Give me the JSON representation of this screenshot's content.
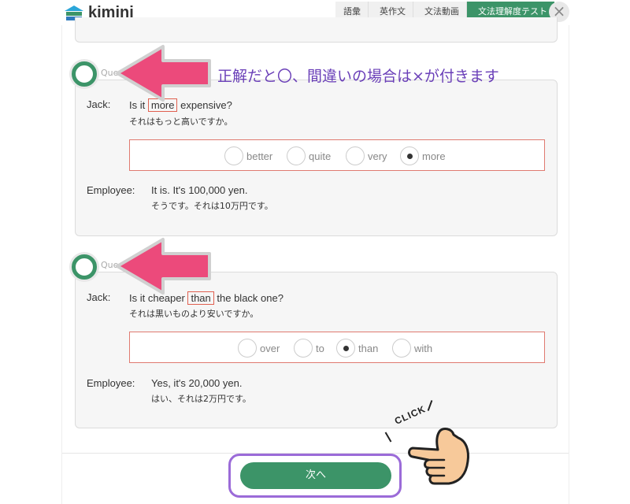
{
  "app": {
    "logo_text": "kimini"
  },
  "nav": {
    "tabs": [
      {
        "label": "語彙"
      },
      {
        "label": "英作文"
      },
      {
        "label": "文法動画"
      },
      {
        "label": "文法理解度テスト"
      }
    ],
    "close_glyph": "×"
  },
  "annotation": {
    "text": "正解だと〇、間違いの場合は×が付きます"
  },
  "questions": [
    {
      "label": "Que",
      "result": "correct",
      "jack_speaker": "Jack:",
      "jack_en_pre": "Is it",
      "jack_en_answer": "more",
      "jack_en_post": "expensive?",
      "jack_ja": "それはもっと高いですか。",
      "options": [
        {
          "label": "better",
          "selected": false
        },
        {
          "label": "quite",
          "selected": false
        },
        {
          "label": "very",
          "selected": false
        },
        {
          "label": "more",
          "selected": true
        }
      ],
      "emp_speaker": "Employee:",
      "emp_en": "It is. It's 100,000 yen.",
      "emp_ja": "そうです。それは10万円です。"
    },
    {
      "label": "Que",
      "result": "correct",
      "jack_speaker": "Jack:",
      "jack_en_pre": "Is it cheaper",
      "jack_en_answer": "than",
      "jack_en_post": "the black one?",
      "jack_ja": "それは黒いものより安いですか。",
      "options": [
        {
          "label": "over",
          "selected": false
        },
        {
          "label": "to",
          "selected": false
        },
        {
          "label": "than",
          "selected": true
        },
        {
          "label": "with",
          "selected": false
        }
      ],
      "emp_speaker": "Employee:",
      "emp_en": "Yes, it's 20,000 yen.",
      "emp_ja": "はい、それは2万円です。"
    }
  ],
  "footer": {
    "next_label": "次へ"
  },
  "callout": {
    "click_text": "CLICK"
  },
  "colors": {
    "accent_green": "#3c9468",
    "arrow_pink": "#ec4a7b",
    "outline_purple": "#9b6bd8",
    "annotation_purple": "#6a3fb8",
    "answer_red": "#e06050",
    "hand_skin": "#f7c99a"
  }
}
